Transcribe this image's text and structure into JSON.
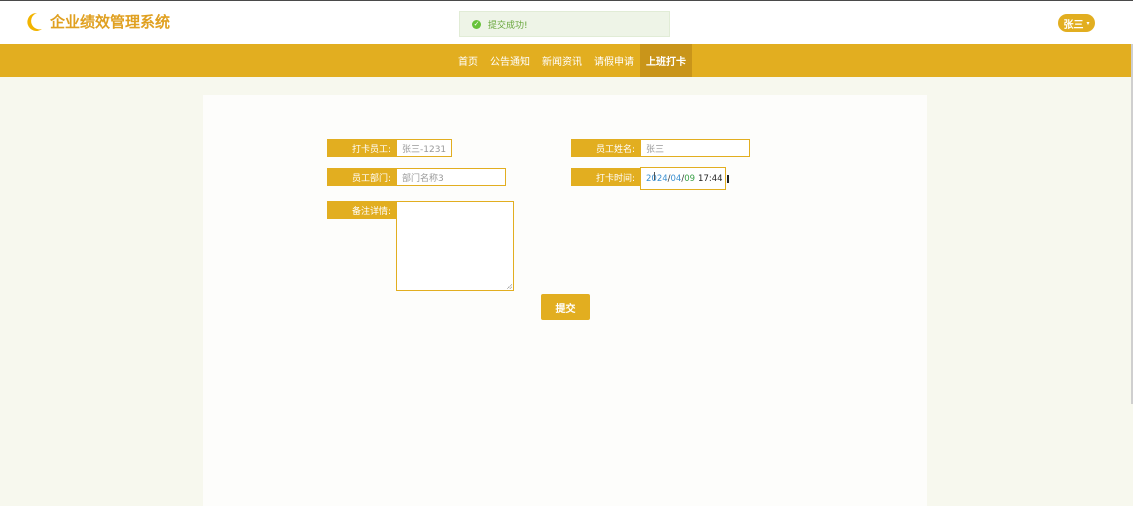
{
  "header": {
    "app_title": "企业绩效管理系统",
    "logo_icon": "moon-icon",
    "user_name": "张三",
    "user_caret": "▾"
  },
  "toast": {
    "message": "提交成功!",
    "icon": "check-circle-icon",
    "icon_glyph": "✓"
  },
  "nav": {
    "items": [
      {
        "label": "首页",
        "active": false
      },
      {
        "label": "公告通知",
        "active": false
      },
      {
        "label": "新闻资讯",
        "active": false
      },
      {
        "label": "请假申请",
        "active": false
      },
      {
        "label": "上班打卡",
        "active": true
      }
    ]
  },
  "form": {
    "employee_label": "打卡员工:",
    "employee_value": "张三-1231",
    "name_label": "员工姓名:",
    "name_value": "张三",
    "dept_label": "员工部门:",
    "dept_value": "部门名称3",
    "time_label": "打卡时间:",
    "time_year": "2024",
    "time_month": "04",
    "time_day": "09",
    "time_clock": "17:44",
    "remark_label": "备注详情:",
    "remark_value": "",
    "submit_label": "提交"
  },
  "colors": {
    "accent": "#e2ae20",
    "accent_dark": "#c9951a",
    "background": "#f7f8ee",
    "toast_bg": "#eef4e7",
    "toast_text": "#67a63a"
  }
}
